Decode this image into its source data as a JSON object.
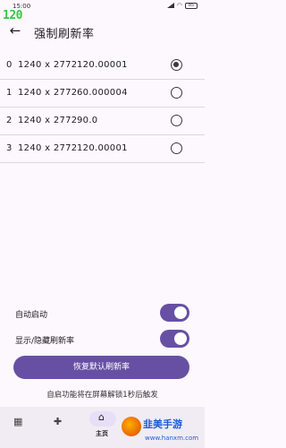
{
  "status_bar": {
    "time": "15:00",
    "battery": "85"
  },
  "overlay": {
    "fps_counter": "120"
  },
  "app_bar": {
    "title": "强制刷新率"
  },
  "modes": [
    {
      "index": "0",
      "resolution": "1240 x 2772",
      "refresh_rate": "120.00001",
      "selected": true
    },
    {
      "index": "1",
      "resolution": "1240 x 2772",
      "refresh_rate": "60.000004",
      "selected": false
    },
    {
      "index": "2",
      "resolution": "1240 x 2772",
      "refresh_rate": "90.0",
      "selected": false
    },
    {
      "index": "3",
      "resolution": "1240 x 2772",
      "refresh_rate": "120.00001",
      "selected": false
    }
  ],
  "settings": {
    "auto_start_label": "自动启动",
    "auto_start_enabled": true,
    "show_rate_label": "显示/隐藏刷新率",
    "show_rate_enabled": true,
    "restore_button": "恢复默认刷新率",
    "hint": "自启功能将在屏幕解锁1秒后触发"
  },
  "bottom_nav": {
    "items": [
      {
        "icon": "grid-icon"
      },
      {
        "icon": "puzzle-icon"
      },
      {
        "icon": "home-icon",
        "label": "主页",
        "active": true
      }
    ]
  },
  "watermark": {
    "text": "韭美手游",
    "url": "www.hanxm.com"
  },
  "colors": {
    "accent": "#6750a4",
    "background": "#fdf8fd",
    "overlay_green": "#2ecc40"
  }
}
